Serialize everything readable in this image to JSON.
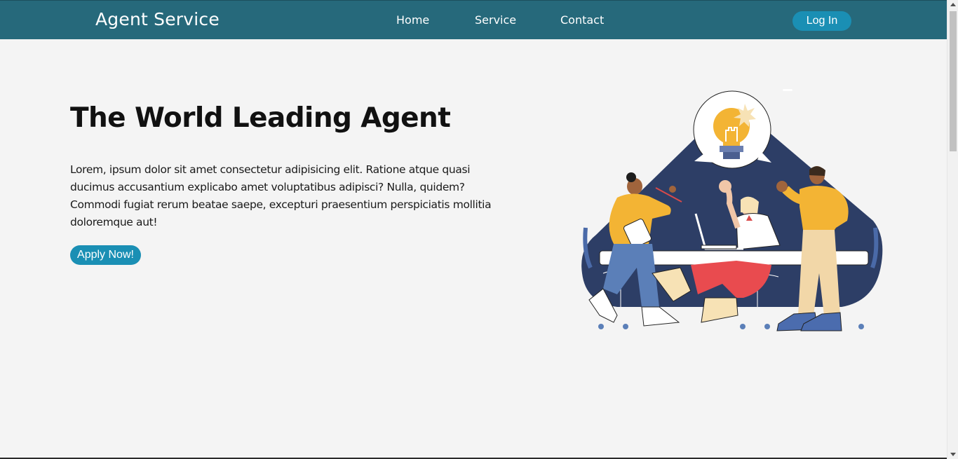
{
  "navbar": {
    "brand": "Agent Service",
    "links": [
      {
        "label": "Home"
      },
      {
        "label": "Service"
      },
      {
        "label": "Contact"
      }
    ],
    "login_label": "Log In"
  },
  "hero": {
    "title": "The World Leading Agent",
    "text": "Lorem, ipsum dolor sit amet consectetur adipisicing elit. Ratione atque quasi ducimus accusantium explicabo amet voluptatibus adipisci? Nulla, quidem? Commodi fugiat rerum beatae saepe, excepturi praesentium perspiciatis mollitia doloremque aut!",
    "cta_label": "Apply Now!"
  },
  "colors": {
    "navbar_bg": "#26697b",
    "button_bg": "#1a8fb4",
    "page_bg": "#f4f4f4",
    "illustration_navy": "#2d3e66"
  },
  "illustration": {
    "icon": "team-meeting-illustration"
  }
}
